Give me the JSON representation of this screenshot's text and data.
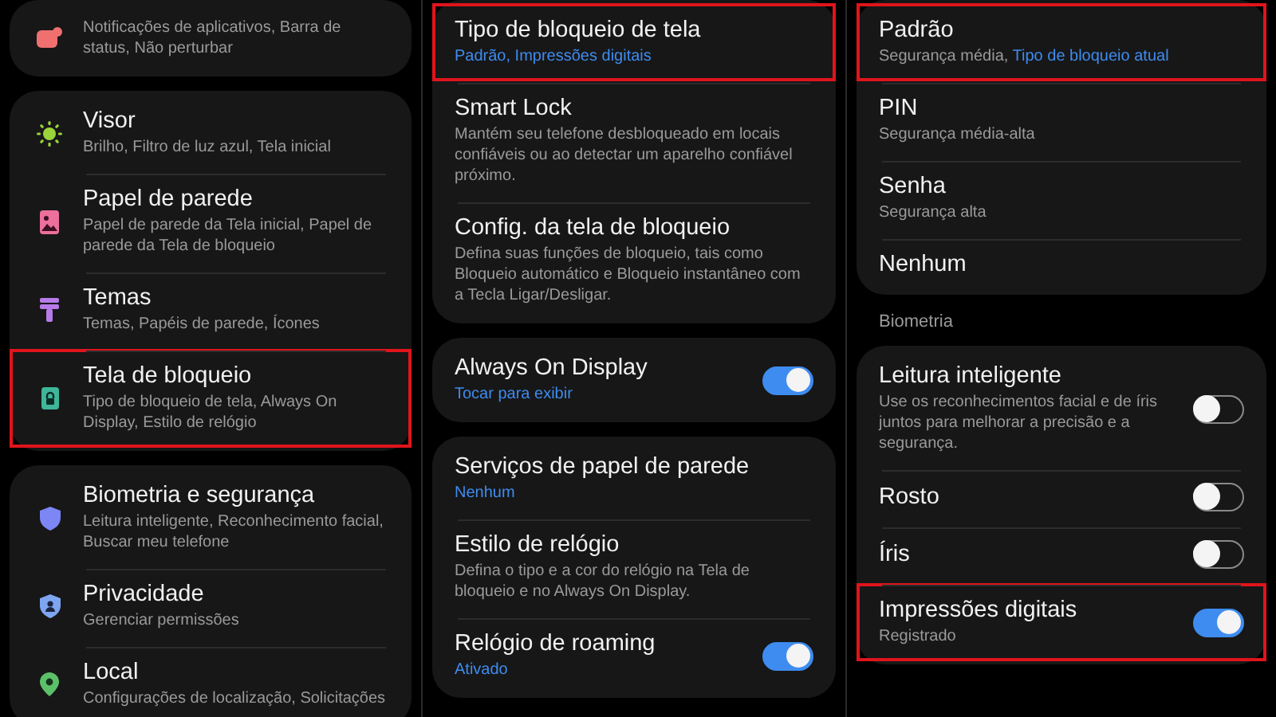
{
  "panels": [
    {
      "blocks": [
        {
          "kind": "card",
          "items": [
            {
              "kind": "bell",
              "subtitle": "Notificações de aplicativos, Barra de status, Não perturbar",
              "highlighted": false
            }
          ]
        },
        {
          "kind": "card",
          "items": [
            {
              "kind": "sun",
              "title": "Visor",
              "subtitle": "Brilho, Filtro de luz azul, Tela inicial",
              "highlighted": false
            },
            {
              "kind": "image",
              "title": "Papel de parede",
              "subtitle": "Papel de parede da Tela inicial, Papel de parede da Tela de bloqueio",
              "highlighted": false
            },
            {
              "kind": "brush",
              "title": "Temas",
              "subtitle": "Temas, Papéis de parede, Ícones",
              "highlighted": false
            },
            {
              "kind": "lock",
              "title": "Tela de bloqueio",
              "subtitle": "Tipo de bloqueio de tela, Always On Display, Estilo de relógio",
              "highlighted": true
            }
          ]
        },
        {
          "kind": "card",
          "items": [
            {
              "kind": "shield",
              "title": "Biometria e segurança",
              "subtitle": "Leitura inteligente, Reconhecimento facial, Buscar meu telefone",
              "highlighted": false
            },
            {
              "kind": "shield-person",
              "title": "Privacidade",
              "subtitle": "Gerenciar permissões",
              "highlighted": false
            },
            {
              "kind": "pin",
              "title": "Local",
              "subtitle": "Configurações de localização, Solicitações",
              "highlighted": false
            }
          ]
        }
      ]
    },
    {
      "blocks": [
        {
          "kind": "card",
          "items": [
            {
              "kind": "plain",
              "title": "Tipo de bloqueio de tela",
              "subtitle_link": "Padrão, Impressões digitais",
              "highlighted": true
            },
            {
              "kind": "plain",
              "title": "Smart Lock",
              "subtitle": "Mantém seu telefone desbloqueado em locais confiáveis ou ao detectar um aparelho confiável próximo.",
              "highlighted": false
            },
            {
              "kind": "plain",
              "title": "Config. da tela de bloqueio",
              "subtitle": "Defina suas funções de bloqueio, tais como Bloqueio automático e Bloqueio instantâneo com a Tecla Ligar/Desligar.",
              "highlighted": false
            }
          ]
        },
        {
          "kind": "card",
          "items": [
            {
              "kind": "toggle",
              "title": "Always On Display",
              "subtitle_link": "Tocar para exibir",
              "on": true,
              "highlighted": false
            }
          ]
        },
        {
          "kind": "card",
          "items": [
            {
              "kind": "plain",
              "title": "Serviços de papel de parede",
              "subtitle_link": "Nenhum",
              "highlighted": false
            },
            {
              "kind": "plain",
              "title": "Estilo de relógio",
              "subtitle": "Defina o tipo e a cor do relógio na Tela de bloqueio e no Always On Display.",
              "highlighted": false
            },
            {
              "kind": "toggle",
              "title": "Relógio de roaming",
              "subtitle_link": "Ativado",
              "on": true,
              "highlighted": false
            }
          ]
        }
      ]
    },
    {
      "blocks": [
        {
          "kind": "card",
          "items": [
            {
              "kind": "plain",
              "title": "Padrão",
              "subtitle": "Segurança média, ",
              "subtitle_link": "Tipo de bloqueio atual",
              "highlighted": true
            },
            {
              "kind": "plain",
              "title": "PIN",
              "subtitle": "Segurança média-alta",
              "highlighted": false
            },
            {
              "kind": "plain",
              "title": "Senha",
              "subtitle": "Segurança alta",
              "highlighted": false
            },
            {
              "kind": "plain",
              "title": "Nenhum",
              "highlighted": false
            }
          ]
        },
        {
          "kind": "header",
          "label": "Biometria"
        },
        {
          "kind": "card",
          "items": [
            {
              "kind": "toggle",
              "title": "Leitura inteligente",
              "subtitle": "Use os reconhecimentos facial e de íris juntos para melhorar a precisão e a segurança.",
              "on": false,
              "highlighted": false
            },
            {
              "kind": "toggle",
              "title": "Rosto",
              "on": false,
              "highlighted": false
            },
            {
              "kind": "toggle",
              "title": "Íris",
              "on": false,
              "highlighted": false
            },
            {
              "kind": "toggle",
              "title": "Impressões digitais",
              "subtitle": "Registrado",
              "on": true,
              "highlighted": true
            }
          ]
        }
      ]
    }
  ]
}
